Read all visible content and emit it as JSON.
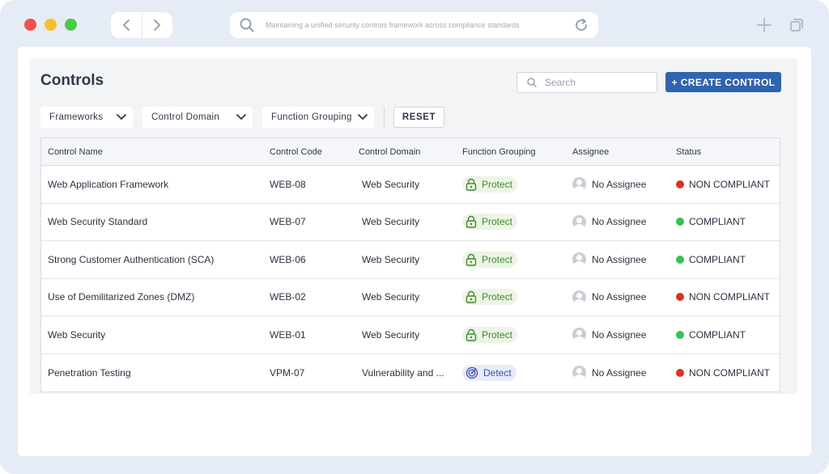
{
  "browser": {
    "address_text": "Maintaining a unified security controls framework across compliance standards"
  },
  "page": {
    "title": "Controls",
    "search_placeholder": "Search",
    "create_label": "+ CREATE CONTROL"
  },
  "filters": [
    {
      "label": "Frameworks"
    },
    {
      "label": "Control Domain"
    },
    {
      "label": "Function Grouping"
    }
  ],
  "reset_label": "RESET",
  "table": {
    "headers": [
      "Control Name",
      "Control Code",
      "Control Domain",
      "Function Grouping",
      "Assignee",
      "Status"
    ],
    "rows": [
      {
        "name": "Web Application Framework",
        "code": "WEB-08",
        "domain": "Web Security",
        "function": "Protect",
        "function_icon": "lock-icon",
        "assignee": "No Assignee",
        "status": "NON COMPLIANT",
        "status_color": "#d9312b"
      },
      {
        "name": "Web Security Standard",
        "code": "WEB-07",
        "domain": "Web Security",
        "function": "Protect",
        "function_icon": "lock-icon",
        "assignee": "No Assignee",
        "status": "COMPLIANT",
        "status_color": "#35c24f"
      },
      {
        "name": "Strong Customer Authentication (SCA)",
        "code": "WEB-06",
        "domain": "Web Security",
        "function": "Protect",
        "function_icon": "lock-icon",
        "assignee": "No Assignee",
        "status": "COMPLIANT",
        "status_color": "#35c24f"
      },
      {
        "name": "Use of Demilitarized Zones (DMZ)",
        "code": "WEB-02",
        "domain": "Web Security",
        "function": "Protect",
        "function_icon": "lock-icon",
        "assignee": "No Assignee",
        "status": "NON COMPLIANT",
        "status_color": "#d9312b"
      },
      {
        "name": "Web Security",
        "code": "WEB-01",
        "domain": "Web Security",
        "function": "Protect",
        "function_icon": "lock-icon",
        "assignee": "No Assignee",
        "status": "COMPLIANT",
        "status_color": "#35c24f"
      },
      {
        "name": "Penetration Testing",
        "code": "VPM-07",
        "domain": "Vulnerability and ...",
        "function": "Detect",
        "function_icon": "radar-icon",
        "assignee": "No Assignee",
        "status": "NON COMPLIANT",
        "status_color": "#d9312b"
      }
    ]
  },
  "colors": {
    "primary": "#2f64ae",
    "compliant": "#35c24f",
    "non_compliant": "#d9312b",
    "protect_bg": "#edf4e6",
    "detect_bg": "#e8ebf8"
  }
}
